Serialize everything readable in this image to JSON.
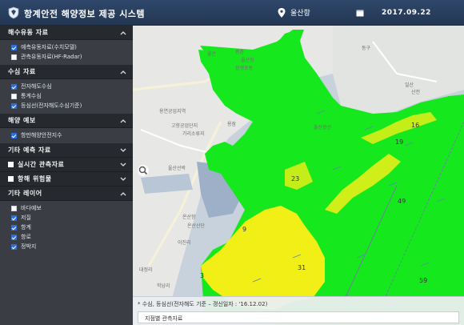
{
  "header": {
    "title": "항계안전 해양정보 제공 시스템",
    "location": "울산항",
    "date": "2017.09.22"
  },
  "sidebar": {
    "sections": [
      {
        "title": "해수유동 자료",
        "lead_box": false,
        "expanded": true,
        "items": [
          {
            "label": "예측유동자료(수치모델)",
            "checked": true
          },
          {
            "label": "관측유동자료(HF-Radar)",
            "checked": false
          }
        ]
      },
      {
        "title": "수심 자료",
        "lead_box": false,
        "expanded": true,
        "items": [
          {
            "label": "전자해도수심",
            "checked": true
          },
          {
            "label": "통계수심",
            "checked": false
          },
          {
            "label": "등심선(전자해도수심기준)",
            "checked": true
          }
        ]
      },
      {
        "title": "해양 예보",
        "lead_box": false,
        "expanded": true,
        "items": [
          {
            "label": "항만해양안전지수",
            "checked": true
          }
        ]
      },
      {
        "title": "기타 예측 자료",
        "lead_box": false,
        "expanded": false,
        "items": []
      },
      {
        "title": "실시간 관측자료",
        "lead_box": true,
        "expanded": false,
        "items": []
      },
      {
        "title": "항해 위험물",
        "lead_box": true,
        "expanded": false,
        "items": []
      },
      {
        "title": "기타 레이어",
        "lead_box": false,
        "expanded": true,
        "items": [
          {
            "label": "바다예보",
            "checked": false
          },
          {
            "label": "저질",
            "checked": true
          },
          {
            "label": "항계",
            "checked": true
          },
          {
            "label": "항로",
            "checked": true
          },
          {
            "label": "정박지",
            "checked": true
          }
        ]
      }
    ]
  },
  "map": {
    "place_labels": [
      "울산",
      "울산항",
      "용연공업지역",
      "고향공업단지",
      "가리소류지",
      "용잠",
      "울산선박",
      "온산항",
      "온산산단",
      "이진리",
      "대정리",
      "학남리",
      "동구",
      "일산",
      "산전",
      "장생포동",
      "평촌",
      "울산장선"
    ],
    "value_labels": [
      "23",
      "49",
      "19",
      "16",
      "31",
      "59",
      "9",
      "3"
    ],
    "accent_colors": {
      "depth_green": "#16e81e",
      "depth_yellow": "#f1ef16",
      "sea": "#c8d2dc",
      "land": "#e7e8e6"
    }
  },
  "info": {
    "note": "* 수심, 등심선(전자해도 기준 – 갱신일자 : '16.12.02)",
    "panel_title": "지점별 관측자료"
  }
}
